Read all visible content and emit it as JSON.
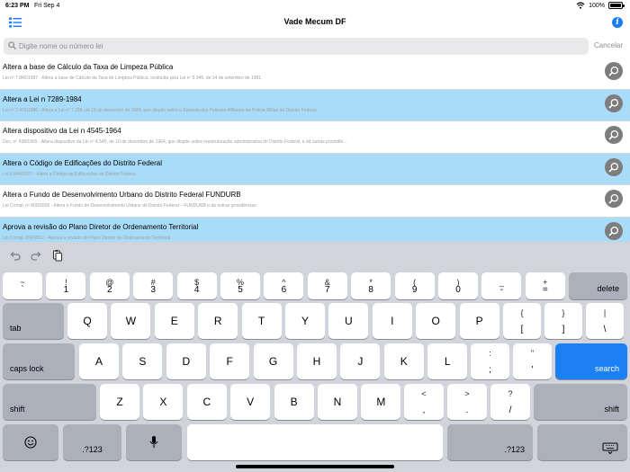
{
  "status": {
    "time": "6:23 PM",
    "date": "Fri Sep 4",
    "battery": "100%"
  },
  "nav": {
    "title": "Vade Mecum DF"
  },
  "search": {
    "placeholder": "Digite nome ou número lei",
    "value": "",
    "cancel": "Cancelar"
  },
  "list": [
    {
      "title": "Altera a base de Cálculo da Taxa de Limpeza Pública",
      "subtitle": "Lei nº 7.840/1997 - Altera a base de Cálculo da Taxa de Limpeza Pública, instituída pela Lei nº 6.945, de 14 de setembro de 1981.",
      "highlighted": false
    },
    {
      "title": "Altera a Lei n 7289-1984",
      "subtitle": "Lei nº 7.475/1986 - Altera a Lei nº 7.289, de 18 de dezembro de 1984, que dispõe sobre o Estatuto dos Policiais-Militares da Polícia Militar do Distrito Federal.",
      "highlighted": true
    },
    {
      "title": "Altera dispositivo da Lei n 4545-1964",
      "subtitle": "Dec. nº 438/1969 - Altera dispositivo da Lei nº 4.545, de 10 de dezembro de 1964, que dispõe sobre reestruturação administrativa do Distrito Federal, e dá outras providên...",
      "highlighted": false
    },
    {
      "title": "Altera o Código de Edificações do Distrito Federal",
      "subtitle": "Lei 5.844/2017 - Altera o Código de Edificações do Distrito Federal",
      "highlighted": true
    },
    {
      "title": "Altera o Fundo de Desenvolvimento Urbano do Distrito Federal FUNDURB",
      "subtitle": "Lei Compl. nº 800/2009 - Altera o Fundo de Desenvolvimento Urbano do Distrito Federal – FUNDURB e dá outras providências.",
      "highlighted": false
    },
    {
      "title": "Aprova a revisão do Plano Diretor de Ordenamento Territorial",
      "subtitle": "Lei Compl. 854/2012 - Aprova a revisão do Plano Diretor de Ordenamento Territorial",
      "highlighted": true
    }
  ],
  "keyboard": {
    "row1": [
      {
        "top": "~",
        "bot": "`"
      },
      {
        "top": "!",
        "bot": "1"
      },
      {
        "top": "@",
        "bot": "2"
      },
      {
        "top": "#",
        "bot": "3"
      },
      {
        "top": "$",
        "bot": "4"
      },
      {
        "top": "%",
        "bot": "5"
      },
      {
        "top": "^",
        "bot": "6"
      },
      {
        "top": "&",
        "bot": "7"
      },
      {
        "top": "*",
        "bot": "8"
      },
      {
        "top": "(",
        "bot": "9"
      },
      {
        "top": ")",
        "bot": "0"
      },
      {
        "top": "_",
        "bot": "-"
      },
      {
        "top": "+",
        "bot": "="
      }
    ],
    "delete": "delete",
    "tab": "tab",
    "row2": [
      "Q",
      "W",
      "E",
      "R",
      "T",
      "Y",
      "U",
      "I",
      "O",
      "P"
    ],
    "row2sym": [
      {
        "top": "{",
        "bot": "["
      },
      {
        "top": "}",
        "bot": "]"
      },
      {
        "top": "|",
        "bot": "\\"
      }
    ],
    "capslock": "caps lock",
    "row3": [
      "A",
      "S",
      "D",
      "F",
      "G",
      "H",
      "J",
      "K",
      "L"
    ],
    "row3sym": [
      {
        "top": ":",
        "bot": ";"
      },
      {
        "top": "\"",
        "bot": "'"
      }
    ],
    "search": "search",
    "shift": "shift",
    "row4": [
      "Z",
      "X",
      "C",
      "V",
      "B",
      "N",
      "M"
    ],
    "row4sym": [
      {
        "top": "<",
        "bot": ","
      },
      {
        "top": ">",
        "bot": "."
      },
      {
        "top": "?",
        "bot": "/"
      }
    ],
    "num": ".?123"
  }
}
